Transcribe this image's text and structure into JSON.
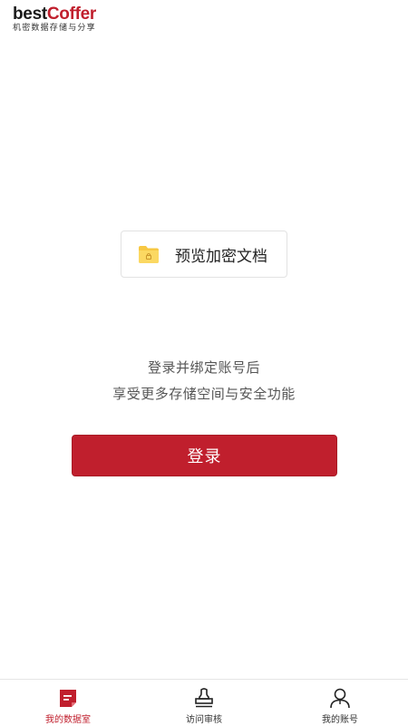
{
  "brand": {
    "logo_best": "best",
    "logo_coffer": "Coffer",
    "tagline": "机密数据存储与分享"
  },
  "main": {
    "preview_label": "预览加密文档",
    "promo_line1": "登录并绑定账号后",
    "promo_line2": "享受更多存储空间与安全功能",
    "login_label": "登录"
  },
  "tabbar": {
    "active_tab": "我的数据室",
    "items": [
      {
        "label": "我的数据室",
        "icon": "data-room-icon"
      },
      {
        "label": "访问审核",
        "icon": "stamp-icon"
      },
      {
        "label": "我的账号",
        "icon": "user-icon"
      }
    ]
  },
  "colors": {
    "accent": "#c01f2d",
    "folder": "#f7c843",
    "text": "#222222",
    "muted": "#555555"
  }
}
